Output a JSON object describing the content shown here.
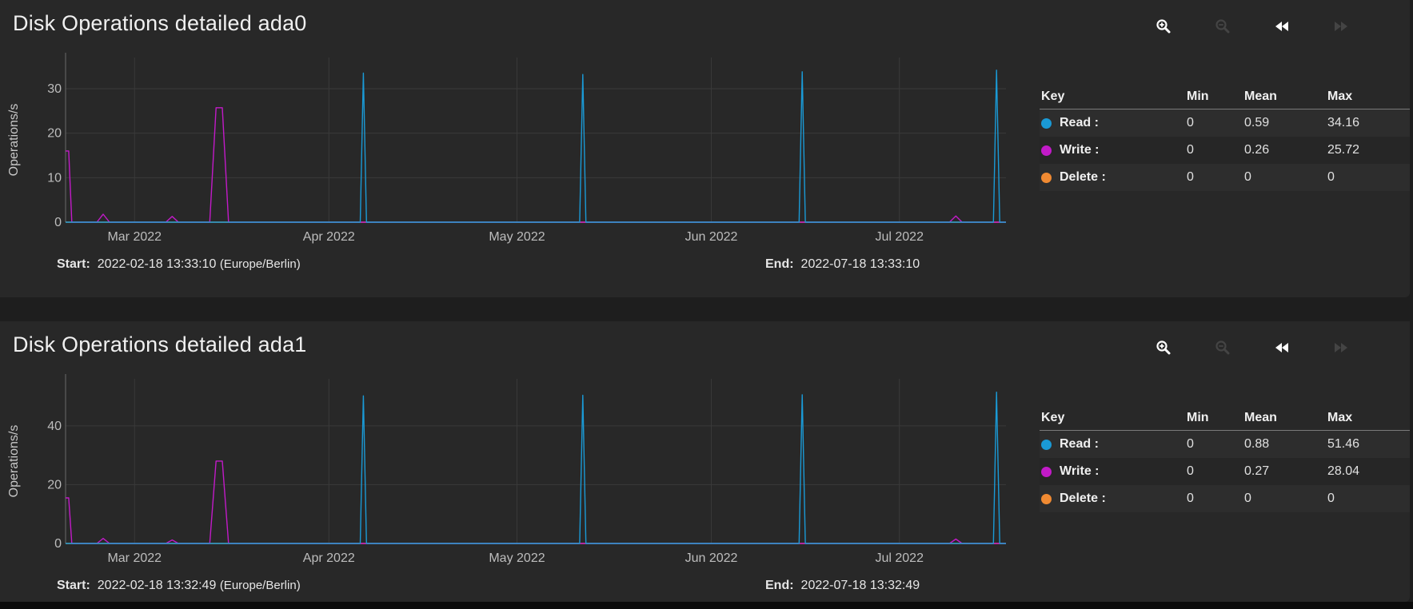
{
  "icons": {
    "zoom_in": "zoom-in-icon",
    "zoom_out": "zoom-out-icon",
    "step_back": "rewind-icon",
    "step_forward": "fast-forward-icon"
  },
  "colors": {
    "read": "#1a9ad6",
    "write": "#c21ac8",
    "delete": "#f08a32"
  },
  "panels": [
    {
      "title": "Disk Operations detailed ada0",
      "ylabel": "Operations/s",
      "legend": {
        "headers": [
          "Key",
          "Min",
          "Mean",
          "Max"
        ],
        "rows": [
          {
            "key": "Read :",
            "min": "0",
            "mean": "0.59",
            "max": "34.16"
          },
          {
            "key": "Write :",
            "min": "0",
            "mean": "0.26",
            "max": "25.72"
          },
          {
            "key": "Delete :",
            "min": "0",
            "mean": "0",
            "max": "0"
          }
        ]
      },
      "start_label": "Start:",
      "start_value": "2022-02-18 13:33:10",
      "start_tz": "(Europe/Berlin)",
      "end_label": "End:",
      "end_value": "2022-07-18 13:33:10"
    },
    {
      "title": "Disk Operations detailed ada1",
      "ylabel": "Operations/s",
      "legend": {
        "headers": [
          "Key",
          "Min",
          "Mean",
          "Max"
        ],
        "rows": [
          {
            "key": "Read :",
            "min": "0",
            "mean": "0.88",
            "max": "51.46"
          },
          {
            "key": "Write :",
            "min": "0",
            "mean": "0.27",
            "max": "28.04"
          },
          {
            "key": "Delete :",
            "min": "0",
            "mean": "0",
            "max": "0"
          }
        ]
      },
      "start_label": "Start:",
      "start_value": "2022-02-18 13:32:49",
      "start_tz": "(Europe/Berlin)",
      "end_label": "End:",
      "end_value": "2022-07-18 13:32:49"
    }
  ],
  "chart_data": [
    {
      "type": "line",
      "ylabel": "Operations/s",
      "ylim": [
        0,
        37
      ],
      "yticks": [
        0,
        10,
        20,
        30
      ],
      "xlim": [
        "2022-02-18",
        "2022-07-18"
      ],
      "xticks": [
        {
          "date": "2022-03-01",
          "label": "Mar 2022"
        },
        {
          "date": "2022-04-01",
          "label": "Apr 2022"
        },
        {
          "date": "2022-05-01",
          "label": "May 2022"
        },
        {
          "date": "2022-06-01",
          "label": "Jun 2022"
        },
        {
          "date": "2022-07-01",
          "label": "Jul 2022"
        }
      ],
      "grid": true,
      "series": [
        {
          "name": "Read",
          "color": "#1a9ad6",
          "x": [
            "2022-02-18",
            "2022-04-06",
            "2022-04-06T12:00",
            "2022-04-07",
            "2022-05-11",
            "2022-05-11T12:00",
            "2022-05-12",
            "2022-06-15",
            "2022-06-15T12:00",
            "2022-06-16",
            "2022-07-16",
            "2022-07-16T12:00",
            "2022-07-17",
            "2022-07-18"
          ],
          "y": [
            0,
            0,
            33.5,
            0,
            0,
            33.2,
            0,
            0,
            33.8,
            0,
            0,
            34.16,
            0,
            0
          ]
        },
        {
          "name": "Write",
          "color": "#c21ac8",
          "x": [
            "2022-02-18",
            "2022-02-18T12:00",
            "2022-02-19",
            "2022-02-23",
            "2022-02-24",
            "2022-02-25",
            "2022-03-06",
            "2022-03-07",
            "2022-03-08",
            "2022-03-13",
            "2022-03-14",
            "2022-03-15",
            "2022-03-16",
            "2022-03-16T12:00",
            "2022-03-17",
            "2022-07-09",
            "2022-07-10",
            "2022-07-11",
            "2022-07-18"
          ],
          "y": [
            16,
            16,
            0,
            0,
            1.8,
            0,
            0,
            1.3,
            0,
            0,
            25.72,
            25.72,
            0,
            0,
            0,
            0,
            1.4,
            0,
            0
          ]
        },
        {
          "name": "Delete",
          "color": "#f08a32",
          "x": [
            "2022-02-18",
            "2022-07-18"
          ],
          "y": [
            0,
            0
          ]
        }
      ]
    },
    {
      "type": "line",
      "ylabel": "Operations/s",
      "ylim": [
        0,
        56
      ],
      "yticks": [
        0,
        20,
        40
      ],
      "xlim": [
        "2022-02-18",
        "2022-07-18"
      ],
      "xticks": [
        {
          "date": "2022-03-01",
          "label": "Mar 2022"
        },
        {
          "date": "2022-04-01",
          "label": "Apr 2022"
        },
        {
          "date": "2022-05-01",
          "label": "May 2022"
        },
        {
          "date": "2022-06-01",
          "label": "Jun 2022"
        },
        {
          "date": "2022-07-01",
          "label": "Jul 2022"
        }
      ],
      "grid": true,
      "series": [
        {
          "name": "Read",
          "color": "#1a9ad6",
          "x": [
            "2022-02-18",
            "2022-04-06",
            "2022-04-06T12:00",
            "2022-04-07",
            "2022-05-11",
            "2022-05-11T12:00",
            "2022-05-12",
            "2022-06-15",
            "2022-06-15T12:00",
            "2022-06-16",
            "2022-07-16",
            "2022-07-16T12:00",
            "2022-07-17",
            "2022-07-18"
          ],
          "y": [
            0,
            0,
            50.2,
            0,
            0,
            50.4,
            0,
            0,
            50.6,
            0,
            0,
            51.46,
            0,
            0
          ]
        },
        {
          "name": "Write",
          "color": "#c21ac8",
          "x": [
            "2022-02-18",
            "2022-02-18T12:00",
            "2022-02-19",
            "2022-02-23",
            "2022-02-24",
            "2022-02-25",
            "2022-03-06",
            "2022-03-07",
            "2022-03-08",
            "2022-03-13",
            "2022-03-14",
            "2022-03-15",
            "2022-03-16",
            "2022-03-16T12:00",
            "2022-03-17",
            "2022-07-09",
            "2022-07-10",
            "2022-07-11",
            "2022-07-18"
          ],
          "y": [
            15.5,
            15.5,
            0,
            0,
            1.7,
            0,
            0,
            1.2,
            0,
            0,
            28.04,
            28.04,
            0,
            0,
            0,
            0,
            1.5,
            0,
            0
          ]
        },
        {
          "name": "Delete",
          "color": "#f08a32",
          "x": [
            "2022-02-18",
            "2022-07-18"
          ],
          "y": [
            0,
            0
          ]
        }
      ]
    }
  ]
}
